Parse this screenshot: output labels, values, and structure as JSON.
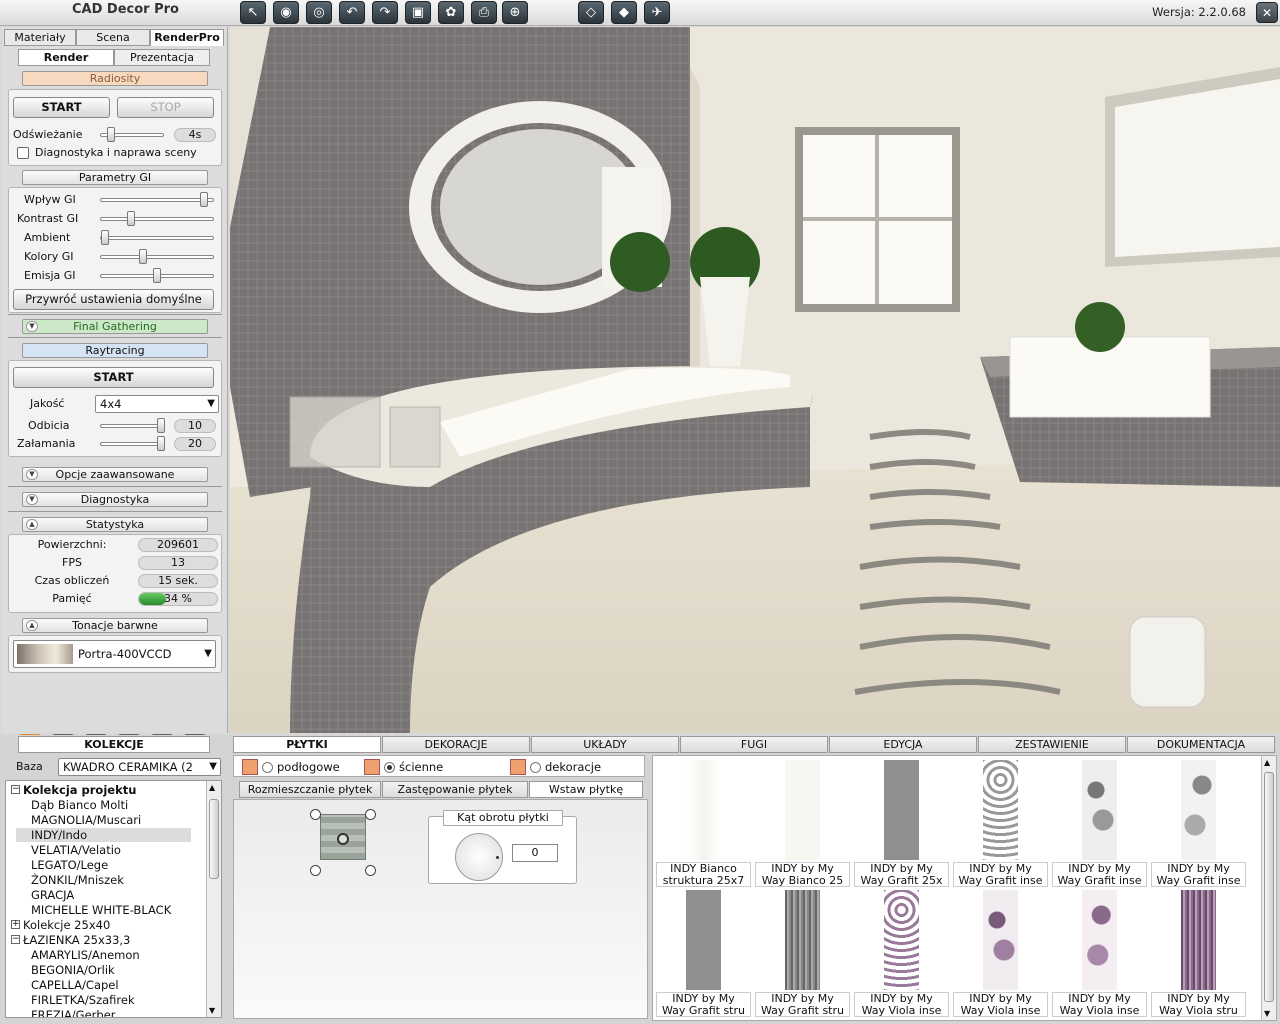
{
  "app": {
    "title": "CAD Decor Pro",
    "version": "Wersja: 2.2.0.68"
  },
  "toolbar": {
    "icons": [
      "select-arrow-icon",
      "eye-icon",
      "eye-alt-icon",
      "undo-icon",
      "redo-icon",
      "save-icon",
      "tulip-icon",
      "print-icon",
      "globe-icon"
    ],
    "view_icons": [
      "cube-view-icon",
      "box-view-icon",
      "plane-icon"
    ]
  },
  "left": {
    "tabs": [
      "Materiały",
      "Scena",
      "RenderPro"
    ],
    "subtabs": [
      "Render",
      "Prezentacja"
    ],
    "radiosity": "Radiosity",
    "start": "START",
    "stop": "STOP",
    "refresh_label": "Odświeżanie",
    "refresh_value": "4s",
    "refresh_level": 0.1,
    "diag_check": "Diagnostyka i naprawa sceny",
    "gi_header": "Parametry GI",
    "gi_params": [
      {
        "label": "Wpływ GI",
        "level": 0.95
      },
      {
        "label": "Kontrast GI",
        "level": 0.25
      },
      {
        "label": "Ambient",
        "level": 0.0
      },
      {
        "label": "Kolory GI",
        "level": 0.37
      },
      {
        "label": "Emisja GI",
        "level": 0.5
      }
    ],
    "restore": "Przywróć ustawienia domyślne",
    "final_gathering": "Final Gathering",
    "raytracing": "Raytracing",
    "rt_start": "START",
    "quality_label": "Jakość",
    "quality_value": "4x4",
    "reflections_label": "Odbicia",
    "reflections_value": "10",
    "refractions_label": "Załamania",
    "refractions_value": "20",
    "advanced": "Opcje zaawansowane",
    "diagnostics": "Diagnostyka",
    "statistics": "Statystyka",
    "stats": [
      {
        "label": "Powierzchni:",
        "value": "209601"
      },
      {
        "label": "FPS",
        "value": "13"
      },
      {
        "label": "Czas obliczeń",
        "value": "15 sek."
      },
      {
        "label": "Pamięć",
        "value": "34 %"
      }
    ],
    "memory_level": 0.34,
    "tone_header": "Tonacje barwne",
    "tone_value": "Portra-400VCCD"
  },
  "bottom": {
    "collections_tab": "KOLEKCJE",
    "base_label": "Baza",
    "base_value": "KWADRO CERAMIKA (2",
    "tree": [
      {
        "text": "Kolekcja projektu",
        "type": "expanded-bold"
      },
      {
        "text": "Dąb Bianco Molti",
        "type": "child"
      },
      {
        "text": "MAGNOLIA/Muscari",
        "type": "child"
      },
      {
        "text": "INDY/Indo",
        "type": "child-selected"
      },
      {
        "text": "VELATIA/Velatio",
        "type": "child"
      },
      {
        "text": "LEGATO/Lege",
        "type": "child"
      },
      {
        "text": "ŻONKIL/Mniszek",
        "type": "child"
      },
      {
        "text": "GRACJA",
        "type": "child"
      },
      {
        "text": "MICHELLE WHITE-BLACK",
        "type": "child"
      },
      {
        "text": "Kolekcje 25x40",
        "type": "collapsed"
      },
      {
        "text": "ŁAZIENKA 25x33,3",
        "type": "expanded"
      },
      {
        "text": "AMARYLIS/Anemon",
        "type": "child"
      },
      {
        "text": "BEGONIA/Orlik",
        "type": "child"
      },
      {
        "text": "CAPELLA/Capel",
        "type": "child"
      },
      {
        "text": "FIRLETKA/Szafirek",
        "type": "child"
      },
      {
        "text": "FREZJA/Gerber",
        "type": "child"
      }
    ],
    "tabs": [
      "PŁYTKI",
      "DEKORACJE",
      "UKŁADY",
      "FUGI",
      "EDYCJA",
      "ZESTAWIENIE",
      "DOKUMENTACJA"
    ],
    "filters": [
      {
        "label": "podłogowe",
        "checked": false
      },
      {
        "label": "ścienne",
        "checked": true
      },
      {
        "label": "dekoracje",
        "checked": false
      }
    ],
    "subtabs": [
      "Rozmieszczanie płytek",
      "Zastępowanie płytek",
      "Wstaw płytkę"
    ],
    "rotation_title": "Kąt obrotu  płytki",
    "rotation_value": "0",
    "tiles": [
      {
        "line1": "INDY Bianco",
        "line2": "struktura 25x7",
        "style": "white"
      },
      {
        "line1": "INDY by My",
        "line2": "Way Bianco 25",
        "style": "white2"
      },
      {
        "line1": "INDY by My",
        "line2": "Way Grafit 25x",
        "style": "grey"
      },
      {
        "line1": "INDY by My",
        "line2": "Way Grafit inse",
        "style": "loops-grey"
      },
      {
        "line1": "INDY by My",
        "line2": "Way Grafit inse",
        "style": "floral-grey"
      },
      {
        "line1": "INDY by My",
        "line2": "Way Grafit inse",
        "style": "floral-grey2"
      },
      {
        "line1": "INDY by My",
        "line2": "Way Grafit stru",
        "style": "grey"
      },
      {
        "line1": "INDY by My",
        "line2": "Way Grafit stru",
        "style": "stripes-grey"
      },
      {
        "line1": "INDY by My",
        "line2": "Way Viola inse",
        "style": "loops-viola"
      },
      {
        "line1": "INDY by My",
        "line2": "Way Viola inse",
        "style": "floral-viola"
      },
      {
        "line1": "INDY by My",
        "line2": "Way Viola inse",
        "style": "floral-viola2"
      },
      {
        "line1": "INDY by My",
        "line2": "Way Viola stru",
        "style": "stripes-viola"
      }
    ]
  },
  "colors": {
    "accent_green": "#3aa63a",
    "radiosity": "#f7d9c0",
    "final_gathering": "#cde8c8",
    "raytracing": "#d4e4f4"
  }
}
